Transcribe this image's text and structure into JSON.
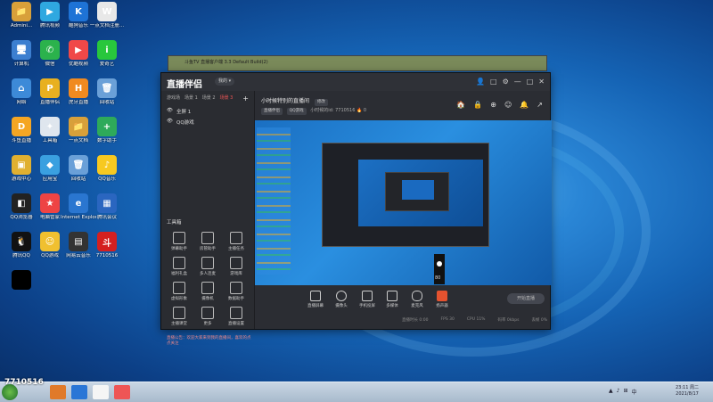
{
  "desktop": {
    "icons": [
      {
        "label": "Admini...",
        "color": "#d8a03a",
        "glyph": "📁"
      },
      {
        "label": "腾讯视频",
        "color": "#2fa8e0",
        "glyph": "▶"
      },
      {
        "label": "酷狗音乐",
        "color": "#1e73d6",
        "glyph": "K"
      },
      {
        "label": "一点文档注册...",
        "color": "#e8e8e8",
        "glyph": "W"
      },
      {
        "label": "计算机",
        "color": "#3c7fd0",
        "glyph": "🖥"
      },
      {
        "label": "微信",
        "color": "#2bb24c",
        "glyph": "✆"
      },
      {
        "label": "优酷视频",
        "color": "#f04848",
        "glyph": "▶"
      },
      {
        "label": "爱奇艺",
        "color": "#28c73c",
        "glyph": "i"
      },
      {
        "label": "网络",
        "color": "#3d8ad8",
        "glyph": "⌂"
      },
      {
        "label": "直播伴侣",
        "color": "#e8b020",
        "glyph": "P"
      },
      {
        "label": "虎牙直播",
        "color": "#f08a20",
        "glyph": "H"
      },
      {
        "label": "回收站",
        "color": "#6aa0d8",
        "glyph": "🗑"
      },
      {
        "label": "斗鱼直播",
        "color": "#f5a623",
        "glyph": "D"
      },
      {
        "label": "工具箱",
        "color": "#dfe6ee",
        "glyph": "✦"
      },
      {
        "label": "一点文档",
        "color": "#d8a03a",
        "glyph": "📁"
      },
      {
        "label": "数字助手",
        "color": "#2eaa5a",
        "glyph": "+"
      },
      {
        "label": "游戏中心",
        "color": "#e0b030",
        "glyph": "▣"
      },
      {
        "label": "应用宝",
        "color": "#3aa0e0",
        "glyph": "◆"
      },
      {
        "label": "回收站",
        "color": "#6aa0d8",
        "glyph": "🗑"
      },
      {
        "label": "QQ音乐",
        "color": "#f7c920",
        "glyph": "♪"
      },
      {
        "label": "QQ浏览器",
        "color": "#222",
        "glyph": "◧"
      },
      {
        "label": "电脑管家",
        "color": "#e44",
        "glyph": "★"
      },
      {
        "label": "Internet Explorer",
        "color": "#2a76d0",
        "glyph": "e"
      },
      {
        "label": "腾讯会议",
        "color": "#2a66c0",
        "glyph": "▦"
      },
      {
        "label": "腾讯QQ",
        "color": "#111",
        "glyph": "🐧"
      },
      {
        "label": "QQ游戏",
        "color": "#f0c030",
        "glyph": "☺"
      },
      {
        "label": "网易云音乐",
        "color": "#333",
        "glyph": "▤"
      },
      {
        "label": "7710516",
        "color": "#d42020",
        "glyph": "斗"
      },
      {
        "label": "",
        "color": "#000",
        "glyph": ""
      }
    ],
    "id_overlay": "7710516"
  },
  "background_window": {
    "title": "斗鱼TV 直播客户端 3.3 Default Build(2)"
  },
  "app": {
    "logo": "直播伴侣",
    "logo_badge": "我的 ▾",
    "window_controls": [
      "👤",
      "□",
      "⚙",
      "—",
      "□",
      "✕"
    ],
    "scene_tabs": [
      "游戏场",
      "场景 1",
      "场景 2",
      "场景 3"
    ],
    "active_tab": "场景 3",
    "add_tab": "+",
    "sources": [
      {
        "label": "全屏 1"
      },
      {
        "label": "QQ游戏"
      }
    ],
    "tools_title": "工具箱",
    "tools": [
      {
        "label": "弹幕助手"
      },
      {
        "label": "房管助手"
      },
      {
        "label": "主播任务"
      },
      {
        "label": "福利礼盒"
      },
      {
        "label": "多人连麦"
      },
      {
        "label": "游戏库"
      },
      {
        "label": "虚拟形象"
      },
      {
        "label": "摄像机"
      },
      {
        "label": "数据助手"
      },
      {
        "label": "主播课堂"
      },
      {
        "label": "更多"
      },
      {
        "label": "直播设置"
      }
    ],
    "notice": "直播公告：欢迎大家来到我的直播间，喜欢的点点关注",
    "room_title": "小时候特别的直播间",
    "room_edit": "修改",
    "room_tags": [
      "直播伴侣",
      "QQ游戏"
    ],
    "room_id": "小时候的id: 7710516",
    "room_count": "0",
    "right_tools": [
      "🏠",
      "🔒",
      "⊕",
      "☺",
      "🔔",
      "↗"
    ],
    "bottom_buttons": [
      {
        "label": "直播屏幕"
      },
      {
        "label": "摄像头"
      },
      {
        "label": "手机投屏"
      },
      {
        "label": "多媒体"
      },
      {
        "label": "麦克风"
      },
      {
        "label": "扬声器"
      }
    ],
    "volume_value": "80",
    "start_button": "开始直播",
    "status_items": [
      "直播时长 0:00",
      "FPS 30",
      "CPU 11%",
      "码率 0kbps",
      "丢帧 0%"
    ]
  },
  "taskbar": {
    "clock_time": "23:11 周二",
    "clock_date": "2021/8/17",
    "tray": [
      "▲",
      "♪",
      "⊞",
      "中"
    ]
  }
}
